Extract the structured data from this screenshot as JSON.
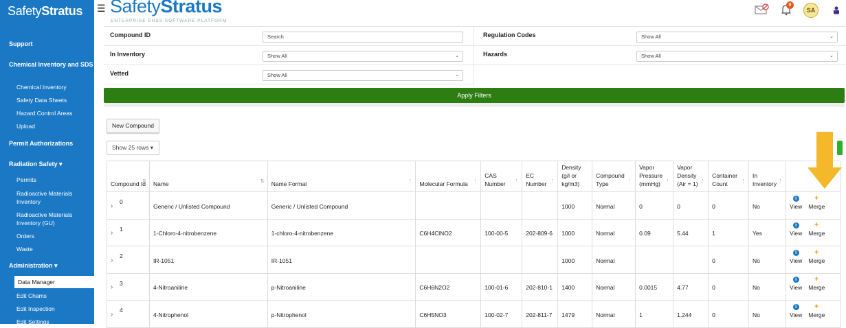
{
  "sidebar": {
    "logo_light": "Safety",
    "logo_bold": "Stratus",
    "sections": [
      {
        "label": "Support"
      },
      {
        "label": "Chemical Inventory and SDS",
        "items": [
          "Chemical Inventory",
          "Safety Data Sheets",
          "Hazard Control Areas",
          "Upload"
        ]
      },
      {
        "label": "Permit Authorizations"
      },
      {
        "label": "Radiation Safety ▾",
        "items": [
          "Permits",
          "Radioactive Materials Inventory",
          "Radioactive Materials Inventory (GU)",
          "Orders",
          "Waste"
        ]
      },
      {
        "label": "Administration ▾",
        "items": [
          "Data Manager",
          "Edit Chams",
          "Edit Inspection",
          "Edit Settings"
        ]
      }
    ]
  },
  "header": {
    "brand_light": "Safety",
    "brand_bold": "Stratus",
    "tagline": "ENTERPRISE EH&S SOFTWARE PLATFORM",
    "notification_count": "0",
    "avatar_initials": "SA"
  },
  "filters": {
    "compound_id_label": "Compound ID",
    "compound_id_placeholder": "Search",
    "regulation_label": "Regulation Codes",
    "regulation_value": "Show All",
    "inventory_label": "In Inventory",
    "inventory_value": "Show All",
    "hazards_label": "Hazards",
    "hazards_value": "Show All",
    "vetted_label": "Vetted",
    "vetted_value": "Show All",
    "apply_label": "Apply Filters"
  },
  "toolbar": {
    "new_compound": "New Compound",
    "rows_label": "Show 25 rows"
  },
  "table": {
    "columns": [
      "Compound Id",
      "Name",
      "Name Formal",
      "Molecular Formula",
      "CAS Number",
      "EC Number",
      "Density (g/l or kg/m3)",
      "Compound Type",
      "Vapor Pressure (mmHg)",
      "Vapor Density (Air = 1)",
      "Container Count",
      "In Inventory",
      ""
    ],
    "rows": [
      {
        "id": "0",
        "name": "Generic / Unlisted Compound",
        "formal": "Generic / Unlisted Compound",
        "formula": "",
        "cas": "",
        "ec": "",
        "density": "1000",
        "type": "Normal",
        "vp": "0",
        "vd": "0",
        "count": "0",
        "inv": "No"
      },
      {
        "id": "1",
        "name": "1-Chloro-4-nitrobenzene",
        "formal": "1-chloro-4-nitrobenzene",
        "formula": "C6H4ClNO2",
        "cas": "100-00-5",
        "ec": "202-809-6",
        "density": "1000",
        "type": "Normal",
        "vp": "0.09",
        "vd": "5.44",
        "count": "1",
        "inv": "Yes"
      },
      {
        "id": "2",
        "name": "IR-1051",
        "formal": "IR-1051",
        "formula": "",
        "cas": "",
        "ec": "",
        "density": "1000",
        "type": "Normal",
        "vp": "",
        "vd": "",
        "count": "0",
        "inv": "No"
      },
      {
        "id": "3",
        "name": "4-Nitroaniline",
        "formal": "p-Nitroaniline",
        "formula": "C6H6N2O2",
        "cas": "100-01-6",
        "ec": "202-810-1",
        "density": "1400",
        "type": "Normal",
        "vp": "0.0015",
        "vd": "4.77",
        "count": "0",
        "inv": "No"
      },
      {
        "id": "4",
        "name": "4-Nitrophenol",
        "formal": "p-Nitrophenol",
        "formula": "C6H5NO3",
        "cas": "100-02-7",
        "ec": "202-811-7",
        "density": "1479",
        "type": "Normal",
        "vp": "1",
        "vd": "1.244",
        "count": "0",
        "inv": "No"
      }
    ],
    "view_label": "View",
    "merge_label": "Merge"
  },
  "colors": {
    "brand_blue": "#1b78c5",
    "apply_green": "#2e7d13",
    "highlight_arrow": "#f5b82a",
    "merge_orange": "#e8a318"
  },
  "icons": [
    "menu-icon",
    "mail-off-icon",
    "bell-icon",
    "user-lock-icon",
    "info-icon",
    "plus-icon",
    "chevron-right-icon",
    "sort-icon"
  ]
}
